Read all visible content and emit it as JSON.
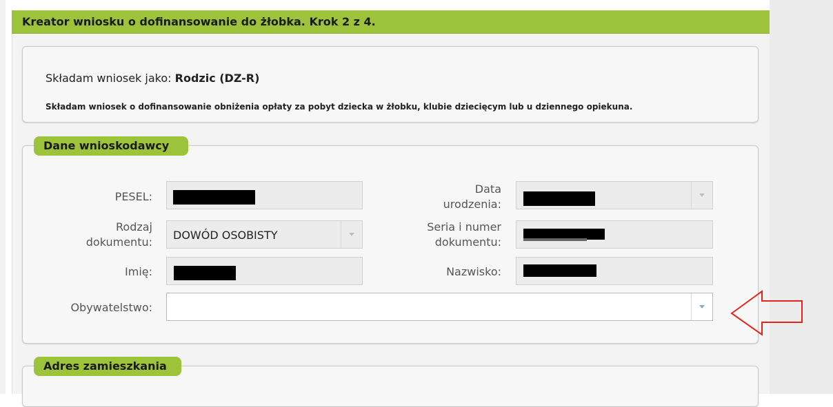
{
  "title": "Kreator wniosku o dofinansowanie do żłobka. Krok 2 z 4.",
  "intro": {
    "applicant_prefix": "Składam wniosek jako:",
    "applicant_role": "Rodzic (DZ-R)",
    "statement": "Składam wniosek o dofinansowanie obniżenia opłaty za pobyt dziecka w żłobku, klubie dziecięcym lub u dziennego opiekuna."
  },
  "sections": {
    "dane": "Dane wnioskodawcy",
    "adres": "Adres zamieszkania"
  },
  "fields": {
    "pesel_label": "PESEL:",
    "data_urodzenia_label_1": "Data",
    "data_urodzenia_label_2": "urodzenia:",
    "rodzaj_label_1": "Rodzaj",
    "rodzaj_label_2": "dokumentu:",
    "rodzaj_value": "DOWÓD OSOBISTY",
    "seria_label_1": "Seria i numer",
    "seria_label_2": "dokumentu:",
    "imie_label": "Imię:",
    "nazwisko_label": "Nazwisko:",
    "obywatelstwo_label": "Obywatelstwo:",
    "obywatelstwo_value": ""
  },
  "annotation": {
    "arrow_color": "#e3241b",
    "arrow_direction": "left"
  }
}
